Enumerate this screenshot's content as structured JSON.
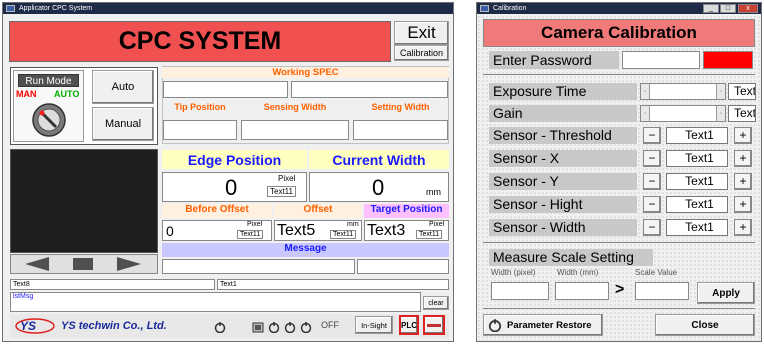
{
  "main_window": {
    "title": "Applicator CPC System",
    "header_title": "CPC SYSTEM",
    "exit_label": "Exit",
    "calibration_label": "Calibration",
    "run_mode_label": "Run Mode",
    "man_label": "MAN",
    "auto_label": "AUTO",
    "auto_button": "Auto",
    "manual_button": "Manual",
    "working_spec_label": "Working SPEC",
    "tip_position_label": "Tip Position",
    "sensing_width_label": "Sensing Width",
    "setting_width_label": "Setting Width",
    "edge_position_label": "Edge Position",
    "current_width_label": "Current Width",
    "edge_value": "0",
    "pixel_label": "Pixel",
    "pixel_value": "Text11",
    "current_value": "0",
    "mm_unit": "mm",
    "before_offset_label": "Before Offset",
    "offset_label": "Offset",
    "target_position_label": "Target Position",
    "before_offset_value": "0",
    "before_pixel_label": "Pixel",
    "before_pixel_value": "Text11",
    "offset_value": "Text5",
    "offset_mm_label": "mm",
    "offset_mm_value": "Text11",
    "target_value": "Text3",
    "target_pixel_label": "Pixel",
    "target_pixel_value": "Text11",
    "message_label": "Message",
    "log_left": "Text8",
    "log_right": "Text1",
    "list_placeholder": "lstMsg",
    "clear_label": "clear",
    "company_name": "YS techwin Co., Ltd.",
    "off_label": "OFF",
    "insight_label": "In-Sight",
    "plc_label": "PLC",
    "colors": {
      "header_bg": "#f05050",
      "accent_blue": "#1a1aff",
      "label_orange": "#ff6000",
      "edge_bg": "#ffffc0",
      "target_bg": "#ffc0ff",
      "message_bg": "#c8c8ff"
    }
  },
  "calib_window": {
    "title": "Calibration",
    "header_title": "Camera Calibration",
    "enter_password_label": "Enter Password",
    "rows": [
      {
        "label": "Exposure Time",
        "value": "Text"
      },
      {
        "label": "Gain",
        "value": "Text"
      },
      {
        "label": "Sensor - Threshold",
        "value": "Text1"
      },
      {
        "label": "Sensor - X",
        "value": "Text1"
      },
      {
        "label": "Sensor - Y",
        "value": "Text1"
      },
      {
        "label": "Sensor - Hight",
        "value": "Text1"
      },
      {
        "label": "Sensor - Width",
        "value": "Text1"
      }
    ],
    "minus": "−",
    "plus": "+",
    "measure_scale_label": "Measure Scale Setting",
    "width_pixel_label": "Width (pixel)",
    "width_mm_label": "Width (mm)",
    "scale_value_label": "Scale Value",
    "apply_label": "Apply",
    "arrow": ">",
    "parameter_restore_label": "Parameter Restore",
    "close_label": "Close",
    "colors": {
      "header_bg": "#f07a7a",
      "password_status": "#ff0000",
      "label_bg": "#c8c8c8"
    }
  }
}
